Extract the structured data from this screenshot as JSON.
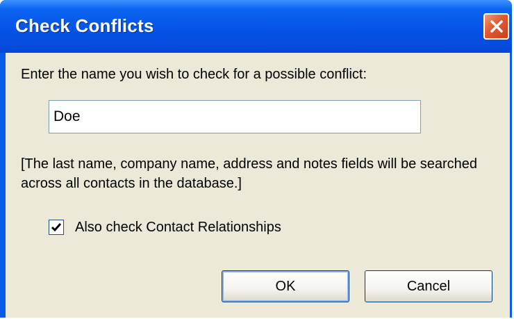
{
  "dialog": {
    "title": "Check Conflicts",
    "prompt": "Enter the name you wish to check for a possible conflict:",
    "name_value": "Doe",
    "note": "[The last name, company name, address and notes fields will be searched across all contacts in the database.]",
    "checkbox_label": "Also check Contact Relationships",
    "checkbox_checked": true,
    "ok_label": "OK",
    "cancel_label": "Cancel"
  },
  "icons": {
    "close": "close-icon",
    "check": "checkmark-icon"
  },
  "colors": {
    "titlebar": "#0551e6",
    "client_bg": "#ece9d8",
    "close_button": "#e0592f"
  }
}
